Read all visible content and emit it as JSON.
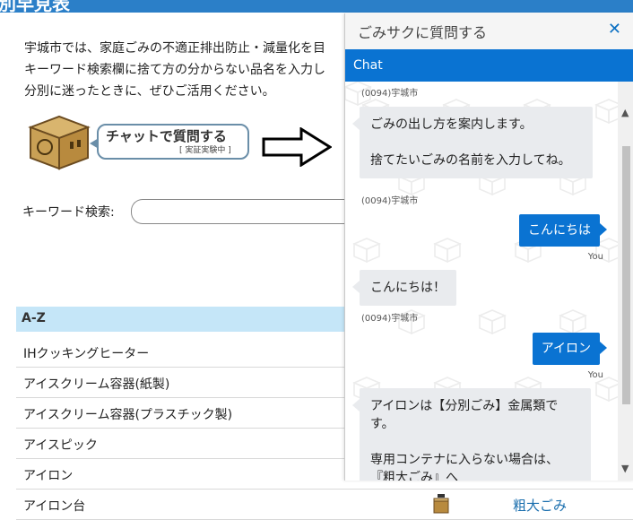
{
  "page": {
    "header_title": "別早見表",
    "intro_lines": [
      "宇城市では、家庭ごみの不適正排出防止・減量化を目",
      "キーワード検索欄に捨て方の分からない品名を入力し",
      "分別に迷ったときに、ぜひご活用ください。"
    ],
    "promo": {
      "main": "チャットで質問する",
      "sub": "[ 実証実験中 ]"
    },
    "keyword_label": "キーワード検索:",
    "keyword_value": "",
    "az_label": "A-Z",
    "items": [
      {
        "name": "IHクッキングヒーター"
      },
      {
        "name": "アイスクリーム容器(紙製)"
      },
      {
        "name": "アイスクリーム容器(プラスチック製)"
      },
      {
        "name": "アイスピック"
      },
      {
        "name": "アイロン"
      },
      {
        "name": "アイロン台",
        "category": "粗大ごみ",
        "icon": "large-waste-box-icon"
      }
    ]
  },
  "chat": {
    "window_title": "ごみサクに質問する",
    "close_glyph": "✕",
    "header": "Chat",
    "messages": [
      {
        "sender": "(0094)宇城市",
        "text_lines": [
          "ごみの出し方を案内します。",
          "",
          "捨てたいごみの名前を入力してね。"
        ]
      },
      {
        "sender": "(0094)宇城市",
        "from": "bot-label-only"
      },
      {
        "from": "user",
        "text": "こんにちは",
        "label": "You"
      },
      {
        "from": "bot",
        "text": "こんにちは！",
        "sender": "(0094)宇城市"
      },
      {
        "from": "user",
        "text": "アイロン",
        "label": "You"
      },
      {
        "from": "bot",
        "text_lines": [
          "アイロンは【分別ごみ】金属類で",
          "す。",
          "",
          "専用コンテナに入らない場合は、",
          "『粗大ごみ』へ"
        ]
      }
    ]
  },
  "colors": {
    "accent": "#0a73d2",
    "header_blue": "#2b7fc8",
    "az_bg": "#c5e6f8",
    "bot_bubble": "#e9ebee",
    "category_link": "#1b6fae"
  }
}
